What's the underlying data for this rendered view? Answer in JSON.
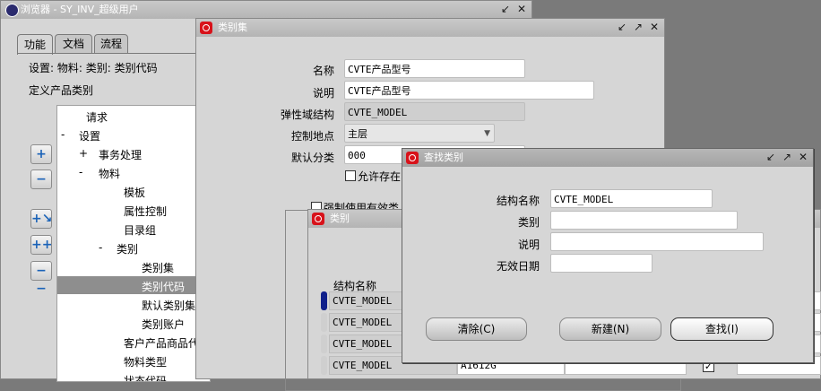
{
  "navigator": {
    "title": "浏览器 - SY_INV_超级用户",
    "tabs": [
      "功能",
      "文档",
      "流程"
    ],
    "path_text": "设置: 物料: 类别: 类别代码",
    "description": "定义产品类别",
    "tree": [
      "请求",
      "设置",
      "事务处理",
      "物料",
      "模板",
      "属性控制",
      "目录组",
      "类别",
      "类别集",
      "类别代码",
      "默认类别集",
      "类别账户",
      "客户产品商品代码",
      "物料类型",
      "状态代码"
    ],
    "tree_markers": {
      "setup": "-",
      "transactions": "+",
      "items": "-",
      "categories": "-"
    }
  },
  "category_set": {
    "title": "类别集",
    "name_label": "名称",
    "name_value": "CVTE产品型号",
    "desc_label": "说明",
    "desc_value": "CVTE产品型号",
    "flex_label": "弹性域结构",
    "flex_value": "CVTE_MODEL",
    "control_label": "控制地点",
    "control_value": "主层",
    "default_label": "默认分类",
    "default_value": "000",
    "allow_label": "允许存在",
    "enforce_label": "强制使用有效类"
  },
  "categories": {
    "title": "类别",
    "column_header": "结构名称",
    "rows": [
      {
        "structure": "CVTE_MODEL",
        "code": "",
        "checked": false
      },
      {
        "structure": "CVTE_MODEL",
        "code": "",
        "checked": false
      },
      {
        "structure": "CVTE_MODEL",
        "code": "",
        "checked": false
      },
      {
        "structure": "CVTE_MODEL",
        "code": "A1612G",
        "checked": true
      }
    ]
  },
  "find_dialog": {
    "title": "查找类别",
    "struct_label": "结构名称",
    "struct_value": "CVTE_MODEL",
    "category_label": "类别",
    "category_value": "",
    "desc_label": "说明",
    "desc_value": "",
    "inactive_label": "无效日期",
    "inactive_value": "",
    "clear_button": "清除(C)",
    "new_button": "新建(N)",
    "find_button": "查找(I)"
  },
  "colors": {
    "oracle_red": "#d8121a",
    "selection": "#8e8e8e",
    "row_marker_current": "#0f1f8a"
  }
}
